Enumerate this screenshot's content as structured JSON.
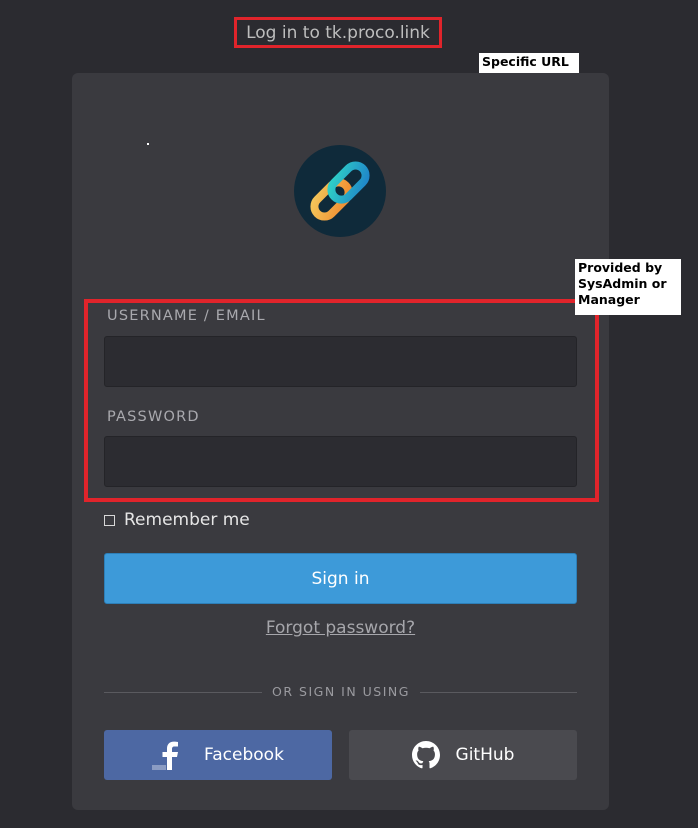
{
  "page": {
    "title": "Log in to tk.proco.link"
  },
  "annotations": {
    "specific_url": "Specific URL",
    "provided_by": "Provided by SysAdmin or Manager"
  },
  "form": {
    "username_label": "USERNAME / EMAIL",
    "username_value": "",
    "password_label": "PASSWORD",
    "password_value": "",
    "remember_label": "Remember me",
    "remember_checked": false,
    "signin_label": "Sign in",
    "forgot_label": "Forgot password?"
  },
  "social": {
    "divider_label": "OR SIGN IN USING",
    "facebook_label": "Facebook",
    "facebook_icon": "facebook-icon",
    "github_label": "GitHub",
    "github_icon": "github-icon"
  },
  "colors": {
    "background": "#2b2b30",
    "card": "#3a3a3f",
    "highlight": "#e0242b",
    "signin": "#3d9ad9",
    "facebook": "#4d68a3",
    "github": "#4a4a4f"
  }
}
